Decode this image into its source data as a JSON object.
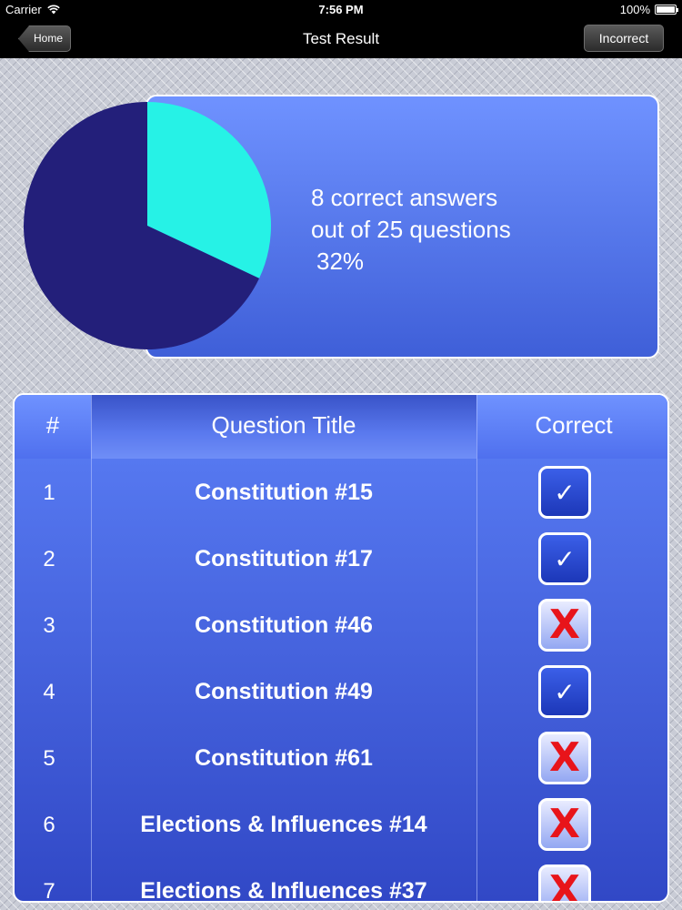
{
  "status_bar": {
    "carrier": "Carrier",
    "time": "7:56 PM",
    "battery": "100%"
  },
  "nav": {
    "back_label": "Home",
    "title": "Test Result",
    "right_label": "Incorrect"
  },
  "summary": {
    "line1": "8 correct answers",
    "line2": "out of 25 questions",
    "percent": "32%"
  },
  "chart_data": {
    "type": "pie",
    "values": [
      8,
      17
    ],
    "colors": [
      "#26f2e6",
      "#231f7a"
    ]
  },
  "table": {
    "headers": {
      "number": "#",
      "title": "Question Title",
      "correct": "Correct"
    },
    "rows": [
      {
        "number": "1",
        "title": "Constitution #15",
        "correct": true,
        "icon": "checkmark-icon"
      },
      {
        "number": "2",
        "title": "Constitution #17",
        "correct": true,
        "icon": "checkmark-icon"
      },
      {
        "number": "3",
        "title": "Constitution #46",
        "correct": false,
        "icon": "x-icon"
      },
      {
        "number": "4",
        "title": "Constitution #49",
        "correct": true,
        "icon": "checkmark-icon"
      },
      {
        "number": "5",
        "title": "Constitution #61",
        "correct": false,
        "icon": "x-icon"
      },
      {
        "number": "6",
        "title": "Elections & Influences #14",
        "correct": false,
        "icon": "x-icon"
      },
      {
        "number": "7",
        "title": "Elections & Influences #37",
        "correct": false,
        "icon": "x-icon"
      }
    ]
  }
}
